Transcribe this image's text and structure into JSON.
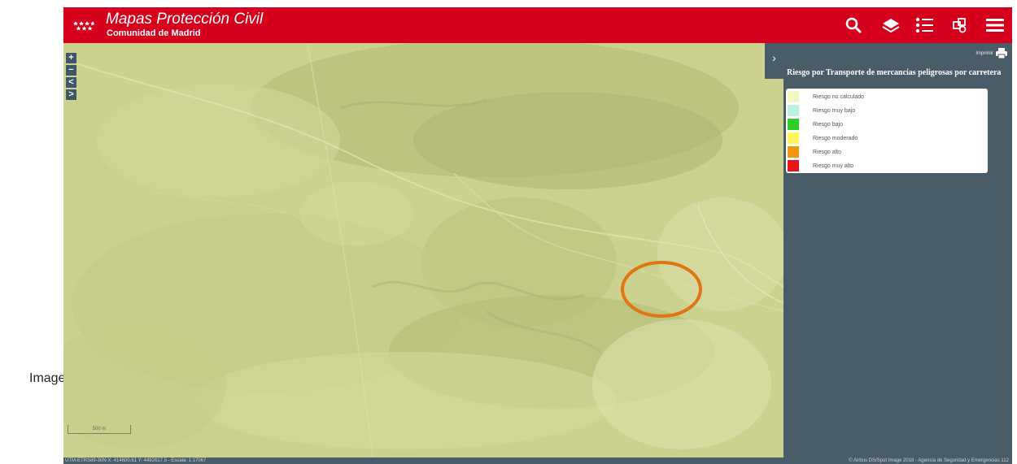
{
  "caption": "Imagen",
  "header": {
    "title": "Mapas Protección Civil",
    "subtitle": "Comunidad de Madrid",
    "brand_color": "#d6001c",
    "buttons": [
      {
        "icon": "search-icon"
      },
      {
        "icon": "layers-icon"
      },
      {
        "icon": "legend-list-icon"
      },
      {
        "icon": "tools-icon"
      },
      {
        "icon": "menu-icon"
      }
    ]
  },
  "map": {
    "zoom_controls": [
      "+",
      "−",
      "<",
      ">"
    ],
    "scale_label": "500 m",
    "highlight_color": "#e07512"
  },
  "panel": {
    "collapse_glyph": "›",
    "print_label": "Imprimir",
    "layer_title": "Riesgo por Transporte de mercancías peligrosas por carretera",
    "legend": [
      {
        "label": "Riesgo no calculado",
        "color": "#f2f6c4"
      },
      {
        "label": "Riesgo muy bajo",
        "color": "#bff0e6"
      },
      {
        "label": "Riesgo bajo",
        "color": "#2fcf2a"
      },
      {
        "label": "Riesgo moderado",
        "color": "#fff45a"
      },
      {
        "label": "Riesgo alto",
        "color": "#f0960e"
      },
      {
        "label": "Riesgo muy alto",
        "color": "#e8141a"
      }
    ],
    "background_color": "#4a5c68"
  },
  "status": {
    "coords": "UTM-ETRS89-30N X: 414600.61  Y: 4492617.5 - Escala: 1:17067",
    "attribution": "© Airbus DS/Spot Image 2018 - Agencia de Seguridad y Emergencias 112"
  }
}
